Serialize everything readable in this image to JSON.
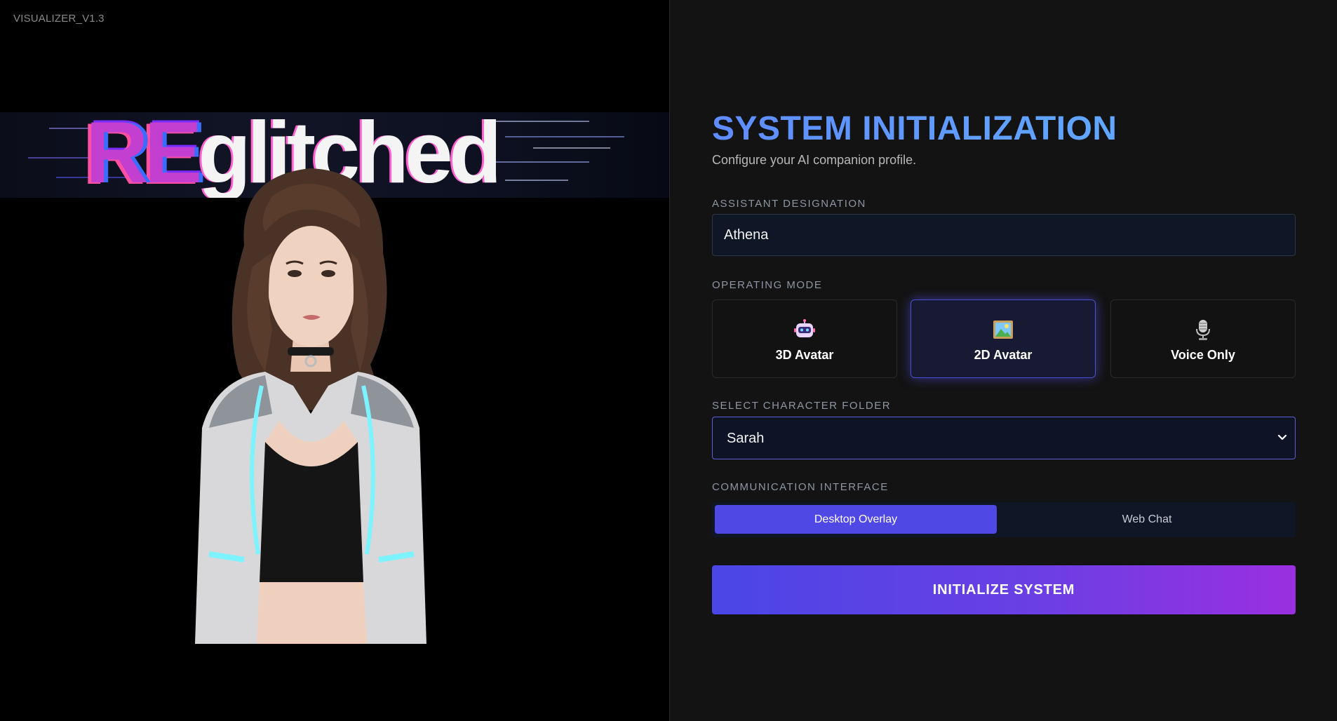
{
  "app": {
    "version_label": "VISUALIZER_V1.3"
  },
  "brand": {
    "logo_prefix": "RE",
    "logo_rest": "glitched"
  },
  "header": {
    "title": "SYSTEM INITIALIZATION",
    "subtitle": "Configure your AI companion profile."
  },
  "form": {
    "designation": {
      "label": "ASSISTANT DESIGNATION",
      "value": "Athena"
    },
    "operating_mode": {
      "label": "OPERATING MODE",
      "options": [
        {
          "label": "3D Avatar",
          "icon": "robot-icon",
          "selected": false
        },
        {
          "label": "2D Avatar",
          "icon": "picture-icon",
          "selected": true
        },
        {
          "label": "Voice Only",
          "icon": "microphone-icon",
          "selected": false
        }
      ]
    },
    "character_folder": {
      "label": "SELECT CHARACTER FOLDER",
      "value": "Sarah"
    },
    "communication": {
      "label": "COMMUNICATION INTERFACE",
      "options": [
        {
          "label": "Desktop Overlay",
          "selected": true
        },
        {
          "label": "Web Chat",
          "selected": false
        }
      ]
    },
    "submit_label": "INITIALIZE SYSTEM"
  },
  "colors": {
    "accent": "#5048e5",
    "title_gradient_start": "#5f8cff",
    "button_gradient_end": "#9a2fe0",
    "panel_bg": "#131313"
  }
}
